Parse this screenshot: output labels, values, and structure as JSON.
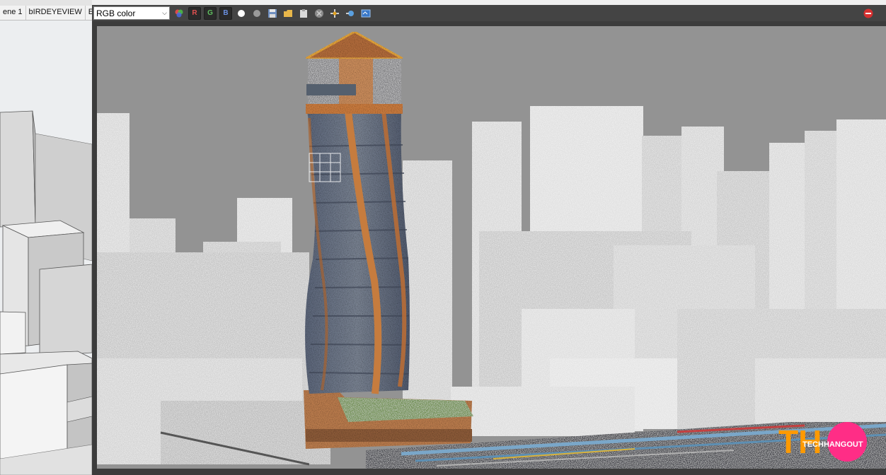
{
  "sketchup": {
    "scene_tabs": [
      {
        "label": "ene 1"
      },
      {
        "label": "bIRDEYEVIEW"
      },
      {
        "label": "ELE"
      }
    ]
  },
  "vfb": {
    "channel_select": {
      "value": "RGB color"
    },
    "channel_buttons": [
      {
        "label": "R",
        "color": "#e05050"
      },
      {
        "label": "G",
        "color": "#5fbf5f"
      },
      {
        "label": "B",
        "color": "#6a8fe0"
      }
    ],
    "toolbar_icons": [
      "color-wheel-icon",
      "white-circle-icon",
      "grey-circle-icon",
      "save-icon",
      "folder-icon",
      "clipboard-icon",
      "clear-icon",
      "follow-mouse-icon",
      "lens-icon",
      "compare-icon",
      "stop-render-icon"
    ]
  },
  "watermark": {
    "text": "TECHHANGOUT",
    "logo_letters": "THO",
    "colors": [
      "#ff3d7f",
      "#ff9a00"
    ]
  }
}
